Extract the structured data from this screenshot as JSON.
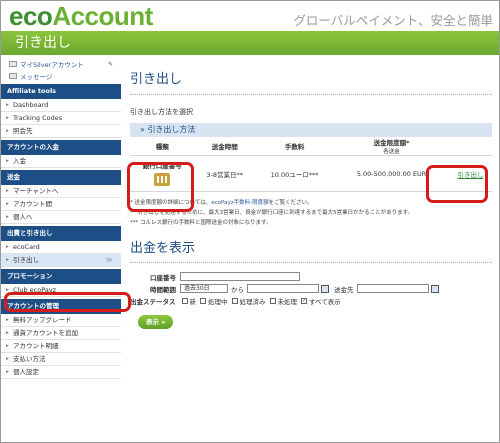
{
  "header": {
    "logo_eco": "eco",
    "logo_account": "Account",
    "tagline": "グローバルペイメント、安全と簡単"
  },
  "page_title": "引き出し",
  "sidebar": {
    "top_links": [
      {
        "label": "マイSilverアカウント",
        "icon": "user-icon",
        "right": "✎"
      },
      {
        "label": "メッセージ",
        "icon": "envelope-icon"
      }
    ],
    "sections": [
      {
        "title": "Affiliate tools",
        "items": [
          "Dashboard",
          "Tracking Codes",
          "照会先"
        ]
      },
      {
        "title": "アカウントの入金",
        "items": [
          "入金"
        ]
      },
      {
        "title": "送金",
        "items": [
          "マーチャントへ",
          "アカウント間",
          "個人へ"
        ]
      },
      {
        "title": "出費と引き出し",
        "items": [
          "ecoCard",
          "引き出し"
        ]
      },
      {
        "title": "プロモーション",
        "items": [
          "Club ecoPayz"
        ]
      },
      {
        "title": "アカウントの管理",
        "items": [
          "無料アップグレード",
          "通貨アカウントを追加",
          "アカウント明細",
          "支払い方法",
          "個人設定"
        ]
      }
    ],
    "active_item": "引き出し",
    "active_marker": "≫"
  },
  "main": {
    "heading": "引き出し",
    "select_method": "引き出し方法を選択",
    "table_title": "» 引き出し方法",
    "columns": [
      "種類",
      "送金時間",
      "手数料",
      "送金限度額*"
    ],
    "columns_sub": [
      "",
      "",
      "",
      "各送金"
    ],
    "rows": [
      {
        "method": "銀行口座番号",
        "time": "3-8営業日**",
        "fee": "10.00ユーロ***",
        "limit": "5.00-500,000.00 EUR",
        "action": "引き出し"
      }
    ],
    "notes": [
      {
        "text": "* 送金限度額の詳細については、",
        "link": "ecoPayz手数料-限度額",
        "tail": "をご覧ください。"
      },
      {
        "text": "** 引き出しを処理するために、最大3営業日、資金が銀行口座に到達するまで最大5営業日かかることがあります。"
      },
      {
        "text": "*** コルレス銀行の手数料と国際送金の対象になります。"
      }
    ],
    "withdrawals_heading": "出金を表示",
    "form": {
      "account_label": "口座番号",
      "period_label": "時間範囲",
      "period_value": "過去30日",
      "from_label": "から",
      "to_label": "送金先",
      "status_label": "出金ステータス",
      "statuses": [
        {
          "label": "新",
          "checked": false
        },
        {
          "label": "処理中",
          "checked": false
        },
        {
          "label": "処理済み",
          "checked": false
        },
        {
          "label": "未処理",
          "checked": false
        },
        {
          "label": "すべて表示",
          "checked": true
        }
      ],
      "submit": "表示 »"
    }
  }
}
